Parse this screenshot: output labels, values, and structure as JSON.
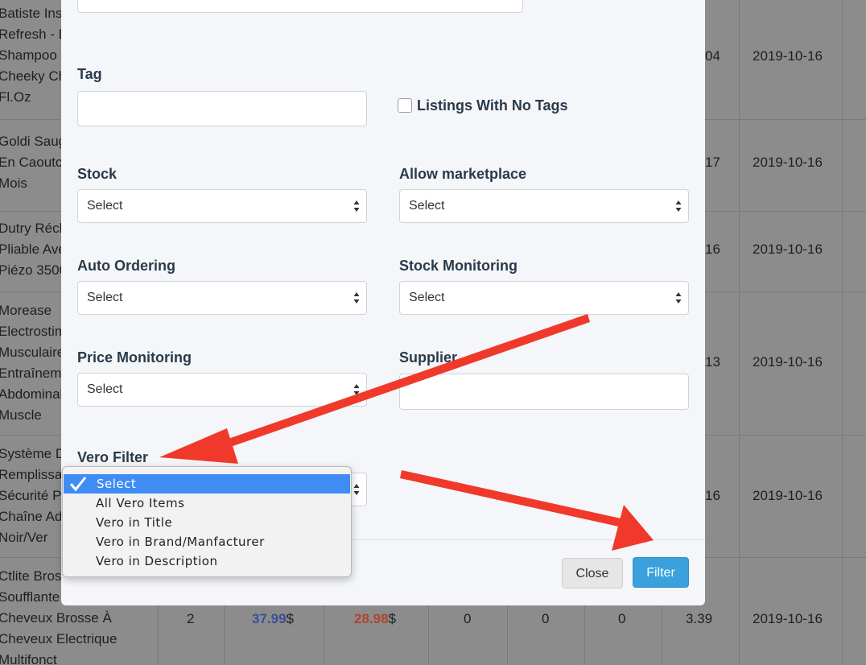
{
  "background_table": {
    "rows": [
      {
        "title_lines": [
          "Batiste Ins",
          "Refresh - D",
          "Shampoo",
          "Cheeky Ch",
          "Fl.Oz"
        ],
        "value_fragment": "04",
        "date": "2019-10-16"
      },
      {
        "title_lines": [
          "Goldi Saug",
          "En Caoutc",
          "Mois"
        ],
        "value_fragment": "17",
        "date": "2019-10-16"
      },
      {
        "title_lines": [
          "Dutry Réch",
          "Pliable Ave",
          "Piézo 3500"
        ],
        "value_fragment": "16",
        "date": "2019-10-16"
      },
      {
        "title_lines": [
          "Morease",
          "Electrostim",
          "Musculaire",
          "Entraînem",
          "Abdominal",
          "Muscle"
        ],
        "value_fragment": "13",
        "date": "2019-10-16"
      },
      {
        "title_lines": [
          "Système D",
          "Remplissa",
          "Sécurité P",
          "Chaîne Ad",
          "Noir/Ver"
        ],
        "value_fragment": "16",
        "date": "2019-10-16"
      },
      {
        "title_lines": [
          "Ctlite Bros",
          "Soufflante",
          "Cheveux Brosse À",
          "Cheveux Electrique",
          "Multifonct"
        ],
        "qty": "2",
        "price_blue": "37.99",
        "price_red": "28.98",
        "currency": "$",
        "zeros": [
          "0",
          "0",
          "0"
        ],
        "value": "3.39",
        "date": "2019-10-16"
      }
    ]
  },
  "modal": {
    "tag_label": "Tag",
    "no_tags_label": "Listings With No Tags",
    "stock_label": "Stock",
    "stock_value": "Select",
    "allow_marketplace_label": "Allow marketplace",
    "allow_marketplace_value": "Select",
    "auto_ordering_label": "Auto Ordering",
    "auto_ordering_value": "Select",
    "stock_monitoring_label": "Stock Monitoring",
    "stock_monitoring_value": "Select",
    "price_monitoring_label": "Price Monitoring",
    "price_monitoring_value": "Select",
    "supplier_label": "Supplier",
    "vero_filter_label": "Vero Filter",
    "close_label": "Close",
    "filter_label": "Filter"
  },
  "vero_dropdown": {
    "options": [
      "Select",
      "All Vero Items",
      "Vero in Title",
      "Vero in Brand/Manfacturer",
      "Vero in Description"
    ],
    "selected": "Select"
  },
  "colors": {
    "annotation_arrow": "#f0392b",
    "primary_button": "#3aa1dd",
    "dropdown_highlight": "#3f8cf5"
  }
}
